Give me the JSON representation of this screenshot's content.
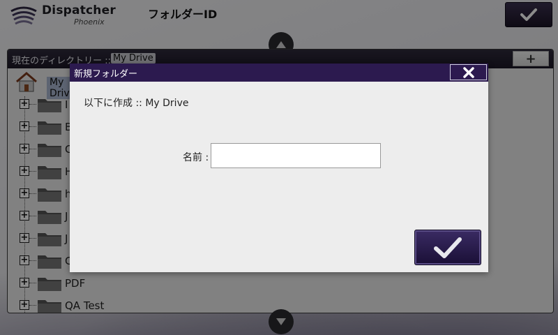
{
  "app": {
    "name": "Dispatcher",
    "subtitle": "Phoenix",
    "page_title": "フォルダーID",
    "confirm_icon": "check-icon"
  },
  "directory": {
    "label": "現在のディレクトリー ::",
    "current": "My Drive",
    "add_button": "+"
  },
  "tree": {
    "root_label": "My Drive",
    "items": [
      {
        "label": "I"
      },
      {
        "label": "B"
      },
      {
        "label": "C"
      },
      {
        "label": "H"
      },
      {
        "label": "h"
      },
      {
        "label": "J"
      },
      {
        "label": "J"
      },
      {
        "label": "C"
      },
      {
        "label": "PDF"
      },
      {
        "label": "QA Test"
      }
    ]
  },
  "dialog": {
    "title": "新規フォルダー",
    "create_under_label": "以下に作成 :: My Drive",
    "name_label": "名前 :",
    "name_value": "",
    "name_placeholder": ""
  },
  "colors": {
    "accent": "#2c1a4f",
    "header_bar": "#1c1826"
  }
}
